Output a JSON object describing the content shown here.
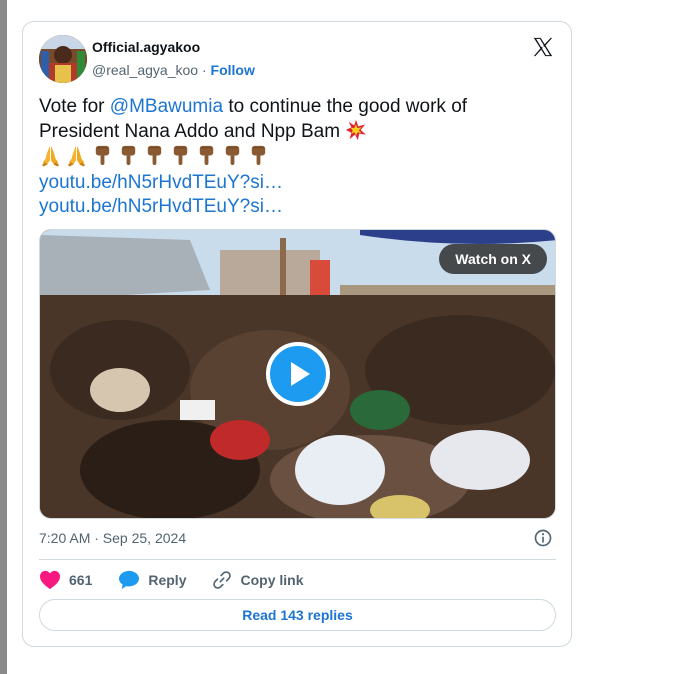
{
  "tweet": {
    "author_name": "Official.agyakoo",
    "handle": "@real_agya_koo",
    "separator": " · ",
    "follow_label": "Follow",
    "text_part1": "Vote for ",
    "mention": "@MBawumia",
    "text_part2": " to continue the good work of President Nana Addo and Npp Bam ",
    "text_emoji": "collision-emoji",
    "emoji_row": [
      "folded-hands-emoji",
      "folded-hands-emoji",
      "point-down-emoji",
      "point-down-emoji",
      "point-down-emoji",
      "point-down-emoji",
      "point-down-emoji",
      "point-down-emoji",
      "point-down-emoji"
    ],
    "links": [
      "youtu.be/hN5rHvdTEuY?si…",
      "youtu.be/hN5rHvdTEuY?si…"
    ],
    "media": {
      "watch_label": "Watch on X",
      "play_icon": "play-icon"
    },
    "timestamp": "7:20 AM · Sep 25, 2024",
    "likes": "661",
    "reply_label": "Reply",
    "copy_link_label": "Copy link",
    "read_replies_label": "Read 143 replies"
  },
  "colors": {
    "link_blue": "#1d75d2",
    "like_pink": "#f91880",
    "play_blue": "#1d9bf0",
    "border": "#cfd9de"
  }
}
